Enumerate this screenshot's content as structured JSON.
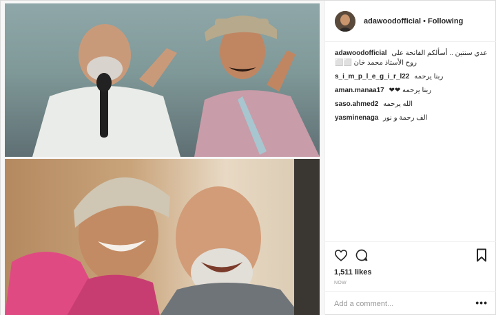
{
  "header": {
    "username": "adawoodofficial",
    "separator": "•",
    "follow_status": "Following"
  },
  "caption": {
    "username": "adawoodofficial",
    "text": "عدي سنتين .. أسألكم الفاتحة على روح الأستاذ محمد خان ⬜⬜"
  },
  "comments": [
    {
      "username": "s_i_m_p_l_e_g_i_r_l22",
      "text": "ربنا يرحمه"
    },
    {
      "username": "aman.manaa17",
      "text": "ربنا يرحمه ❤❤"
    },
    {
      "username": "saso.ahmed2",
      "text": "الله يرحمه"
    },
    {
      "username": "yasminenaga",
      "text": "الف رحمة و نور"
    }
  ],
  "icons": {
    "like": "heart-icon",
    "comment": "comment-bubble-icon",
    "save": "bookmark-icon",
    "more": "more-options-icon"
  },
  "stats": {
    "likes": "1,511 likes",
    "time": "NOW"
  },
  "add_comment": {
    "placeholder": "Add a comment...",
    "more_label": "•••"
  }
}
